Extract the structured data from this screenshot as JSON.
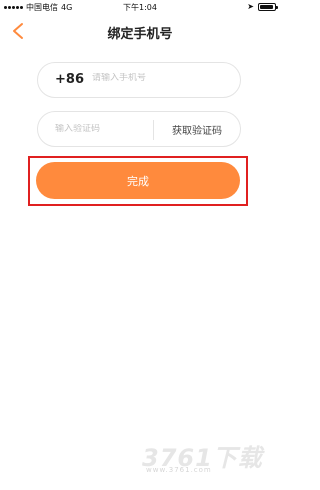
{
  "status_bar": {
    "carrier": "中国电信",
    "network": "4G",
    "time": "下午1:04",
    "battery_level": 0.9
  },
  "header": {
    "title": "绑定手机号",
    "back_icon": "chevron-left-icon"
  },
  "phone_field": {
    "country_code": "+86",
    "placeholder": "请输入手机号",
    "value": ""
  },
  "code_field": {
    "placeholder": "输入验证码",
    "value": "",
    "get_code_label": "获取验证码"
  },
  "submit": {
    "label": "完成"
  },
  "watermark": {
    "logo": "3761下载",
    "url": "www.3761.com"
  },
  "colors": {
    "accent": "#ff8a3d",
    "highlight": "#e02020"
  }
}
